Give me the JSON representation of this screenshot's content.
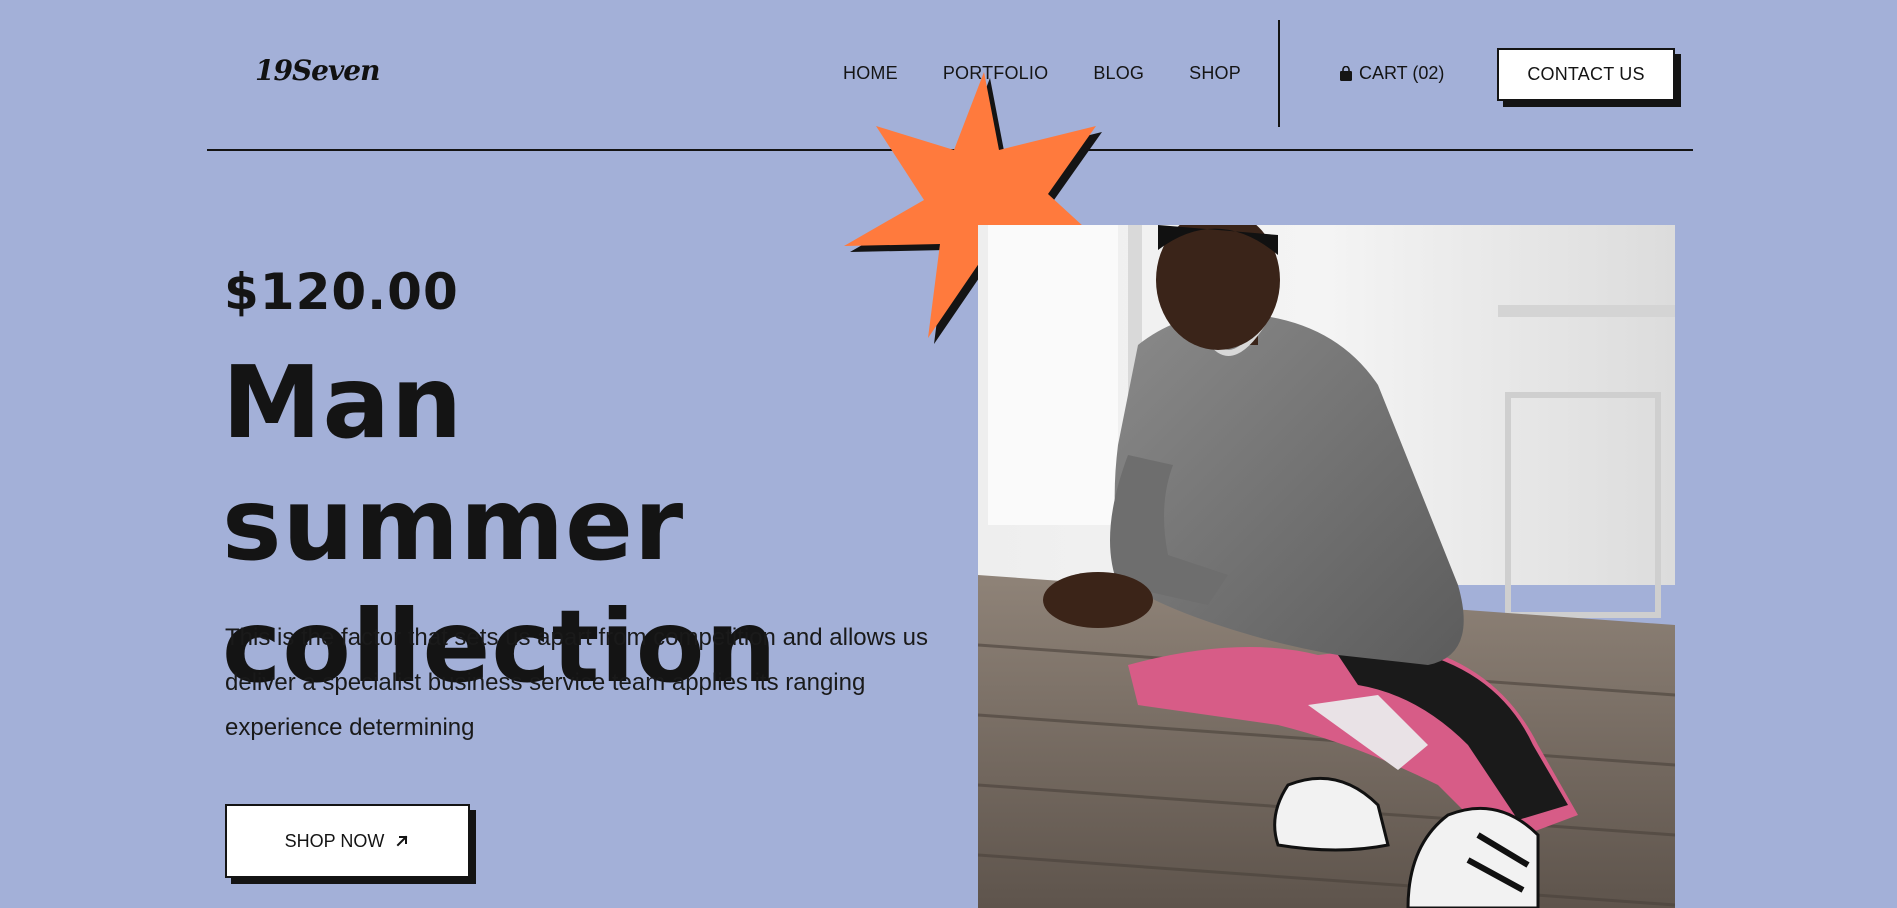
{
  "brand": {
    "logo_text": "19Seven"
  },
  "nav": {
    "items": [
      {
        "label": "HOME"
      },
      {
        "label": "PORTFOLIO"
      },
      {
        "label": "BLOG"
      },
      {
        "label": "SHOP"
      }
    ],
    "cart_label": "CART (02)",
    "cart_icon": "shopping-bag-icon",
    "contact_label": "CONTACT US"
  },
  "hero": {
    "price": "$120.00",
    "title_line1": "Man summer",
    "title_line2": "collection",
    "description": "This is the factor that sets us apart from competition and allows us deliver a specialist business service team applies its ranging experience determining",
    "cta_label": "SHOP NOW",
    "cta_icon": "arrow-up-right-icon",
    "image_icon": "fashion-model-photo"
  },
  "colors": {
    "background": "#a3b0d8",
    "accent_star": "#ff7a3d",
    "ink": "#141414",
    "button_bg": "#ffffff"
  }
}
